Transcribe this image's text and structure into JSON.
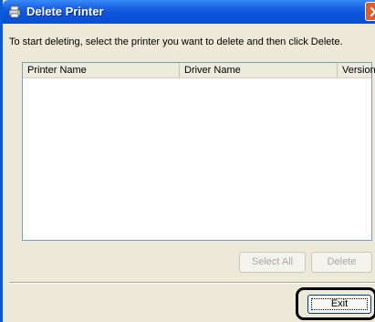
{
  "window": {
    "title": "Delete Printer"
  },
  "instruction": "To start deleting, select the printer you want to delete and then click Delete.",
  "table": {
    "columns": [
      "Printer Name",
      "Driver Name",
      "Version"
    ],
    "rows": []
  },
  "buttons": {
    "select_all": "Select All",
    "delete": "Delete",
    "exit": "Exit"
  },
  "colors": {
    "titlebar": "#0a54dc",
    "close": "#e35a2c",
    "dialog_bg": "#ece9d8"
  },
  "icons": {
    "title": "printer-icon",
    "close": "close-icon"
  }
}
